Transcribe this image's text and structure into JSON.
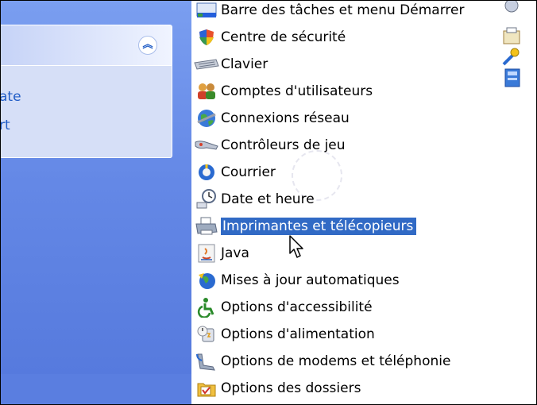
{
  "task_pane": {
    "links": [
      "ate",
      "rt"
    ]
  },
  "items": [
    {
      "label": "Barre des tâches et menu Démarrer",
      "icon": "taskbar-icon",
      "selected": false
    },
    {
      "label": "Centre de sécurité",
      "icon": "shield-icon",
      "selected": false
    },
    {
      "label": "Clavier",
      "icon": "keyboard-icon",
      "selected": false
    },
    {
      "label": "Comptes d'utilisateurs",
      "icon": "users-icon",
      "selected": false
    },
    {
      "label": "Connexions réseau",
      "icon": "network-icon",
      "selected": false
    },
    {
      "label": "Contrôleurs de jeu",
      "icon": "gamepad-icon",
      "selected": false
    },
    {
      "label": "Courrier",
      "icon": "mail-icon",
      "selected": false
    },
    {
      "label": "Date et heure",
      "icon": "clock-icon",
      "selected": false
    },
    {
      "label": "Imprimantes et télécopieurs",
      "icon": "printer-icon",
      "selected": true
    },
    {
      "label": "Java",
      "icon": "java-icon",
      "selected": false
    },
    {
      "label": "Mises à jour automatiques",
      "icon": "update-icon",
      "selected": false
    },
    {
      "label": "Options d'accessibilité",
      "icon": "accessibility-icon",
      "selected": false
    },
    {
      "label": "Options d'alimentation",
      "icon": "power-icon",
      "selected": false
    },
    {
      "label": "Options de modems et téléphonie",
      "icon": "phone-icon",
      "selected": false
    },
    {
      "label": "Options des dossiers",
      "icon": "folder-options-icon",
      "selected": false
    }
  ],
  "colors": {
    "selection": "#316ac5",
    "pane_blue": "#6d8fe8",
    "link": "#215dc6"
  }
}
